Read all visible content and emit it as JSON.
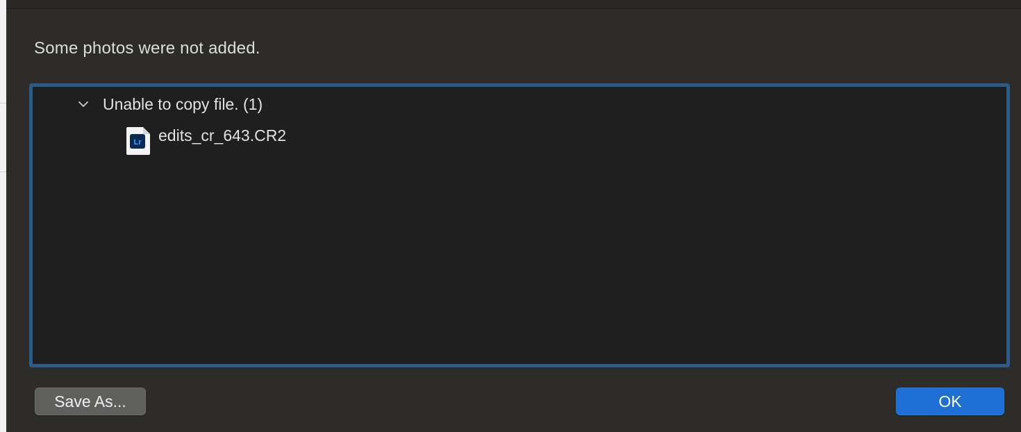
{
  "dialog": {
    "message": "Some photos were not added.",
    "groups": [
      {
        "label": "Unable to copy file. (1)",
        "expanded": true,
        "files": [
          {
            "name": "edits_cr_643.CR2",
            "icon": "lightroom-file-icon",
            "icon_badge": "Lr"
          }
        ]
      }
    ],
    "buttons": {
      "save_as_label": "Save As...",
      "ok_label": "OK"
    }
  },
  "colors": {
    "dialog_bg": "#2d2c29",
    "list_bg": "#1f1f1f",
    "focus_ring": "#2b5d8a",
    "primary_button": "#1d6fd4",
    "secondary_button": "#5f5f5d",
    "lr_badge": "#0a2a55",
    "lr_text": "#31a8ff"
  }
}
